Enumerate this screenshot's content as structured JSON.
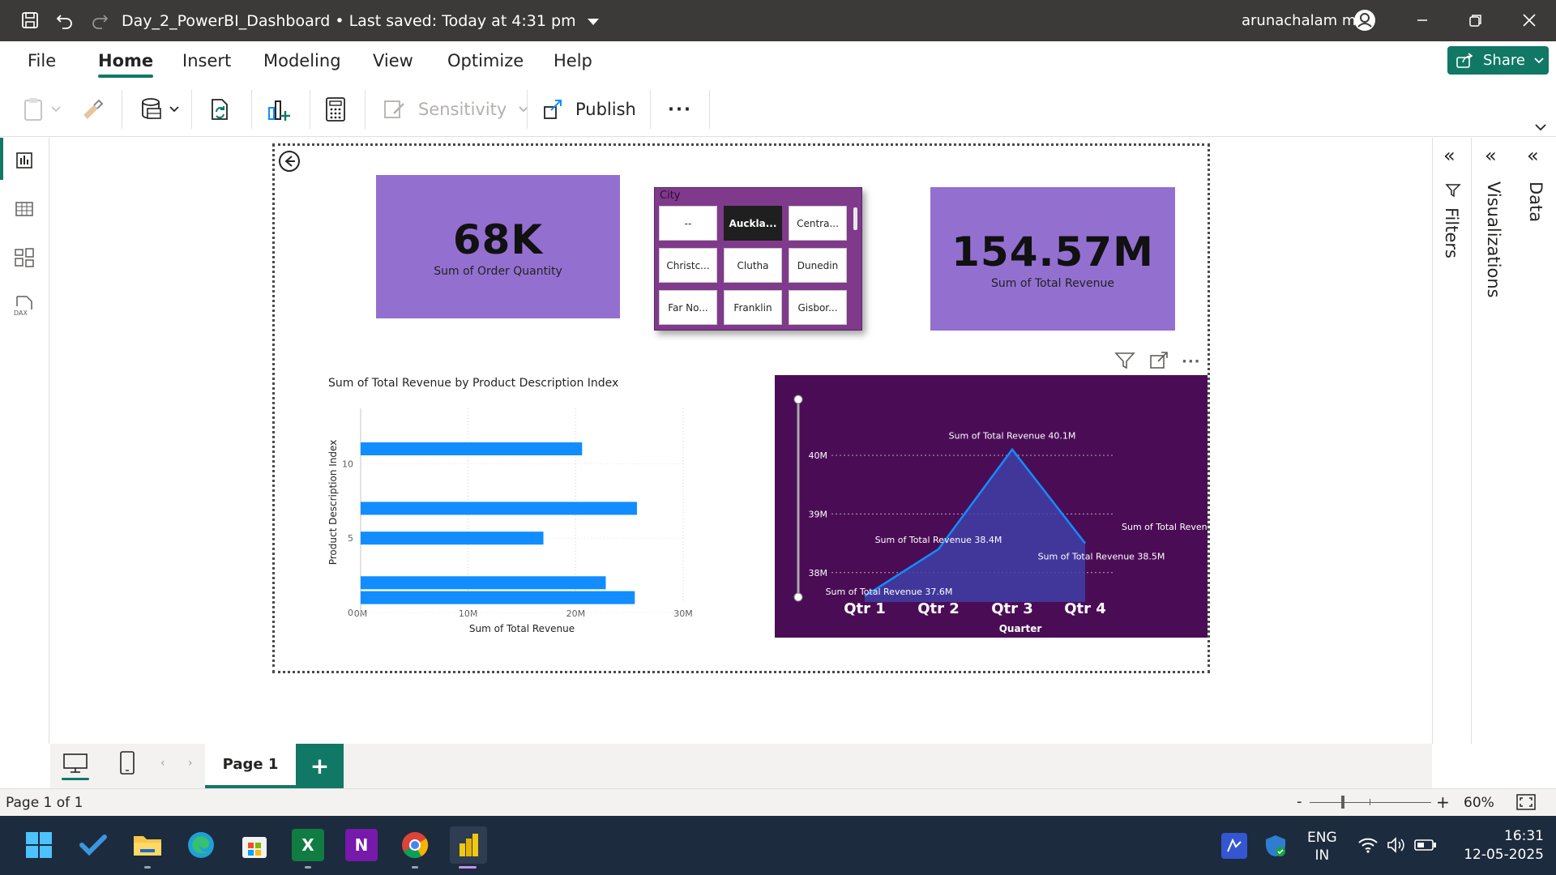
{
  "titlebar": {
    "doc_title": "Day_2_PowerBI_Dashboard",
    "saved": "Last saved: Today at 4:31 pm",
    "separator": "•",
    "user": "arunachalam m"
  },
  "ribbon": {
    "tabs": [
      "File",
      "Home",
      "Insert",
      "Modeling",
      "View",
      "Optimize",
      "Help"
    ],
    "active_tab": "Home",
    "share_label": "Share",
    "sensitivity_label": "Sensitivity",
    "publish_label": "Publish",
    "more_label": "···"
  },
  "panes": {
    "filters": "Filters",
    "visualizations": "Visualizations",
    "data": "Data"
  },
  "cards": [
    {
      "value": "68K",
      "label": "Sum of Order Quantity"
    },
    {
      "value": "154.57M",
      "label": "Sum of Total Revenue"
    }
  ],
  "slicer": {
    "header": "City",
    "items": [
      "--",
      "Auckla...",
      "Centra...",
      "Christc...",
      "Clutha",
      "Dunedin",
      "Far No...",
      "Franklin",
      "Gisbor..."
    ],
    "selected": "Auckla..."
  },
  "page": {
    "tab_label": "Page 1",
    "add_label": "+",
    "status": "Page 1 of 1",
    "zoom": "60%",
    "zoom_minus": "-",
    "zoom_plus": "+"
  },
  "taskbar": {
    "lang": "ENG",
    "region": "IN",
    "time": "16:31",
    "date": "12-05-2025"
  },
  "chart_data": [
    {
      "type": "bar",
      "orientation": "horizontal",
      "title": "Sum of Total Revenue by Product Description Index",
      "xlabel": "Sum of Total Revenue",
      "ylabel": "Product Description Index",
      "x_ticks": [
        "0M",
        "10M",
        "20M",
        "30M"
      ],
      "y_ticks": [
        "0",
        "5",
        "10"
      ],
      "xlim": [
        0,
        30
      ],
      "ylim": [
        0,
        11
      ],
      "unit": "M",
      "bars": [
        {
          "y": 1,
          "value": 25.5
        },
        {
          "y": 2,
          "value": 22.8
        },
        {
          "y": 5,
          "value": 17.0
        },
        {
          "y": 7,
          "value": 25.7
        },
        {
          "y": 11,
          "value": 20.6
        }
      ],
      "color": "#118dff",
      "grid": true
    },
    {
      "type": "area",
      "categories": [
        "Qtr 1",
        "Qtr 2",
        "Qtr 3",
        "Qtr 4"
      ],
      "xlabel": "Quarter",
      "values": [
        37.6,
        38.4,
        40.1,
        38.5
      ],
      "data_labels": [
        "Sum of Total Revenue 37.6M",
        "Sum of Total Revenue 38.4M",
        "Sum of Total Revenue 40.1M",
        "Sum of Total Revenue 38.5M"
      ],
      "legend_text": "Sum of Total Revenue",
      "y_ticks": [
        "38M",
        "39M",
        "40M"
      ],
      "ylim": [
        37.5,
        40.4
      ],
      "background": "#4a0d55",
      "line_color": "#118dff",
      "fill_color": "#3f3fa8",
      "grid": true
    }
  ]
}
